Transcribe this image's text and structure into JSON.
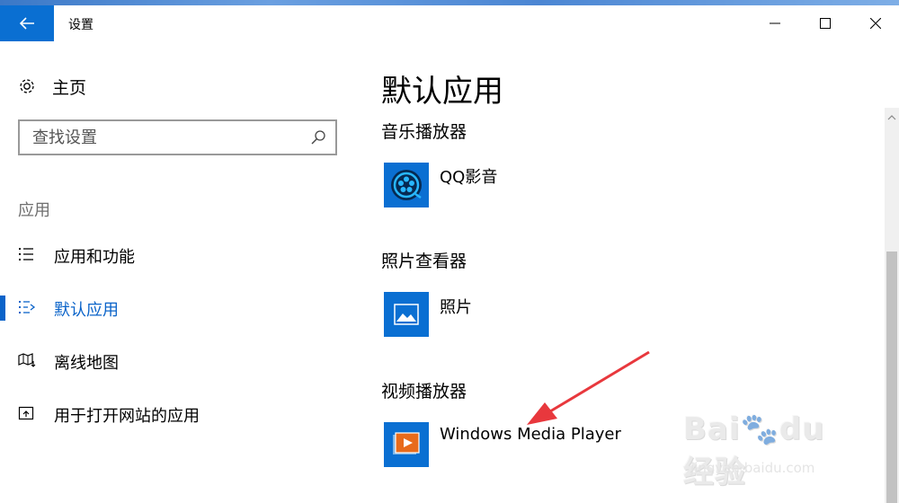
{
  "window": {
    "title": "设置"
  },
  "sidebar": {
    "home_label": "主页",
    "search_placeholder": "查找设置",
    "section_label": "应用",
    "items": [
      {
        "label": "应用和功能",
        "icon": "list-icon",
        "active": false
      },
      {
        "label": "默认应用",
        "icon": "default-apps-icon",
        "active": true
      },
      {
        "label": "离线地图",
        "icon": "map-download-icon",
        "active": false
      },
      {
        "label": "用于打开网站的应用",
        "icon": "open-link-icon",
        "active": false
      }
    ]
  },
  "main": {
    "title": "默认应用",
    "categories": [
      {
        "label": "音乐播放器",
        "app": "QQ影音",
        "icon": "qq-player-icon"
      },
      {
        "label": "照片查看器",
        "app": "照片",
        "icon": "photos-icon"
      },
      {
        "label": "视频播放器",
        "app": "Windows Media Player",
        "icon": "media-player-icon"
      }
    ]
  },
  "watermark": {
    "url": "jingyan.baidu.com"
  },
  "colors": {
    "accent": "#0a6fd2",
    "annotation": "#e8383d"
  }
}
